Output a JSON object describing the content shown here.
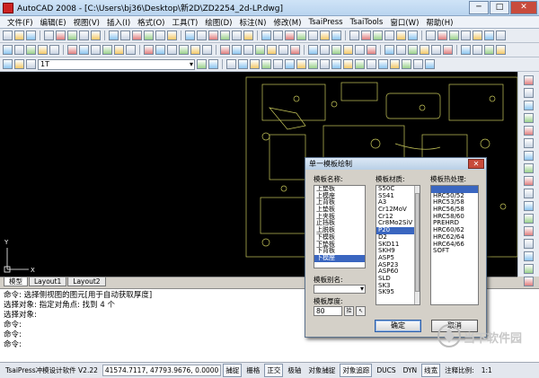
{
  "window": {
    "title": "AutoCAD 2008 - [C:\\Users\\bj36\\Desktop\\新2D\\ZD2254_2d-LP.dwg]",
    "min_label": "─",
    "max_label": "□",
    "close_label": "✕"
  },
  "menu": [
    "文件(F)",
    "编辑(E)",
    "视图(V)",
    "插入(I)",
    "格式(O)",
    "工具(T)",
    "绘图(D)",
    "标注(N)",
    "修改(M)",
    "TsaiPress",
    "TsaiTools",
    "窗口(W)",
    "帮助(H)"
  ],
  "toolbar3": {
    "layer_combo": "1T"
  },
  "tabs": [
    "模型",
    "Layout1",
    "Layout2"
  ],
  "command_lines": [
    "命令: 选择侧视图的图元[用于自动获取厚度]",
    "选择对象: 指定对角点: 找到 4 个",
    "选择对象:",
    "命令:",
    "命令:",
    "",
    "命令:"
  ],
  "status": {
    "app": "TsaiPress冲模设计软件 V2.22",
    "coords": "41574.7117, 47793.9676, 0.0000",
    "toggles": [
      {
        "label": "捕捉",
        "on": true
      },
      {
        "label": "栅格",
        "on": false
      },
      {
        "label": "正交",
        "on": true
      },
      {
        "label": "极轴",
        "on": false
      },
      {
        "label": "对象捕捉",
        "on": false
      },
      {
        "label": "对象追踪",
        "on": true
      },
      {
        "label": "DUCS",
        "on": false
      },
      {
        "label": "DYN",
        "on": false
      },
      {
        "label": "线宽",
        "on": true
      }
    ],
    "scale_label": "注释比例:",
    "scale_value": "1:1"
  },
  "dialog": {
    "title": "单一模板绘制",
    "close": "✕",
    "name_label": "模板名称:",
    "names": [
      "上垫板",
      "上模座",
      "上背板",
      "上垫板",
      "上夹板",
      "止挡板",
      "上脱板",
      "下模板",
      "下垫板",
      "下背板",
      "下模座"
    ],
    "selected_name_index": 10,
    "material_label": "模板材质:",
    "materials": [
      "S50C",
      "SS41",
      "A3",
      "Cr12MoV",
      "Cr12",
      "Cr8Mo2SiV",
      "P20",
      "D2",
      "SKD11",
      "SKH9",
      "ASP5",
      "ASP23",
      "ASP60",
      "SLD",
      "SK3",
      "SK95"
    ],
    "selected_material_index": 6,
    "heat_label": "模板热处理:",
    "heats": [
      "",
      "HRC50/52",
      "HRC53/58",
      "HRC56/58",
      "HRC58/60",
      "PREHRD",
      "HRC60/62",
      "HRC62/64",
      "HRC64/66",
      "SOFT"
    ],
    "selected_heat_index": 0,
    "alias_label": "模板别名:",
    "alias_value": "",
    "thickness_label": "模板厚度:",
    "thickness_value": "80",
    "pick_btn": "拾",
    "ok": "确定",
    "cancel": "取消"
  },
  "watermark": "当下软件园",
  "colors": {
    "canvas": "#000000",
    "drawing": "#c8c85a",
    "select": "#3a66c0"
  }
}
